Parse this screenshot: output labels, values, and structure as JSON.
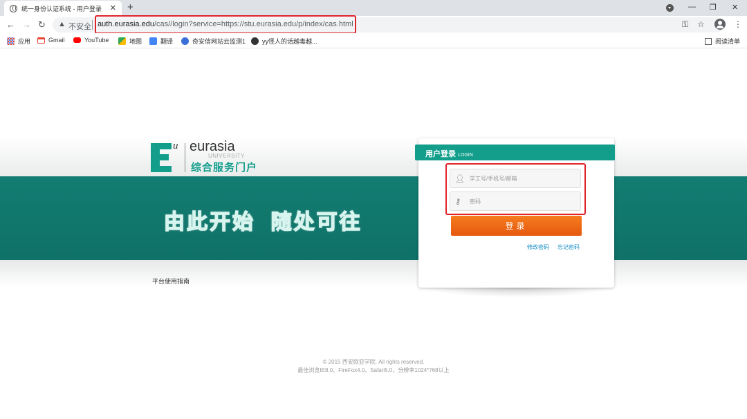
{
  "browser": {
    "tab_title": "统一身份认证系统 - 用户登录",
    "tab_close": "✕",
    "new_tab": "+",
    "window_controls": [
      "—",
      "❐",
      "✕"
    ],
    "security_label": "不安全",
    "url_host": "auth.eurasia.edu",
    "url_rest": "/cas//login?service=https://stu.eurasia.edu/p/index/cas.html",
    "icons": [
      "back-icon",
      "forward-icon",
      "reload-icon",
      "warning-icon",
      "key-icon",
      "star-icon",
      "account-icon"
    ]
  },
  "bookmarks": {
    "items": [
      {
        "label": "应用",
        "icon": "apps-icon",
        "color": "#ea4335"
      },
      {
        "label": "Gmail",
        "icon": "gmail-icon",
        "color": "#ea4335"
      },
      {
        "label": "YouTube",
        "icon": "youtube-icon",
        "color": "#ff0000"
      },
      {
        "label": "地图",
        "icon": "maps-icon",
        "color": "#34a853"
      },
      {
        "label": "翻译",
        "icon": "translate-icon",
        "color": "#4285f4"
      },
      {
        "label": "奇安信网站云监测1",
        "icon": "qianxin-icon",
        "color": "#3b6fd8"
      },
      {
        "label": "yy怪人的话越毒越...",
        "icon": "yy-icon",
        "color": "#333333"
      }
    ],
    "reading_list": "阅读清单"
  },
  "page": {
    "logo_name": "eurasia",
    "logo_sub": "UNIVERSITY",
    "logo_cn": "综合服务门户",
    "logo_u": "u",
    "slogan": "由此开始  随处可往",
    "guide_link": "平台使用指南",
    "brand_color": "#139e8c",
    "band_color": "#137d72"
  },
  "login": {
    "title": "用户登录",
    "title_en": "LOGIN",
    "username_placeholder": "学工号/手机号/邮箱",
    "password_placeholder": "密码",
    "submit_label": "登录",
    "change_password": "修改密码",
    "forgot_password": "忘记密码",
    "button_color": "#f26b1d"
  },
  "footer": {
    "copyright": "© 2015 西安欧亚学院. All rights reserved.",
    "browsers": "最佳浏览IE8.0、FireFox4.0、Safari5.0，分辨率1024*768以上"
  }
}
